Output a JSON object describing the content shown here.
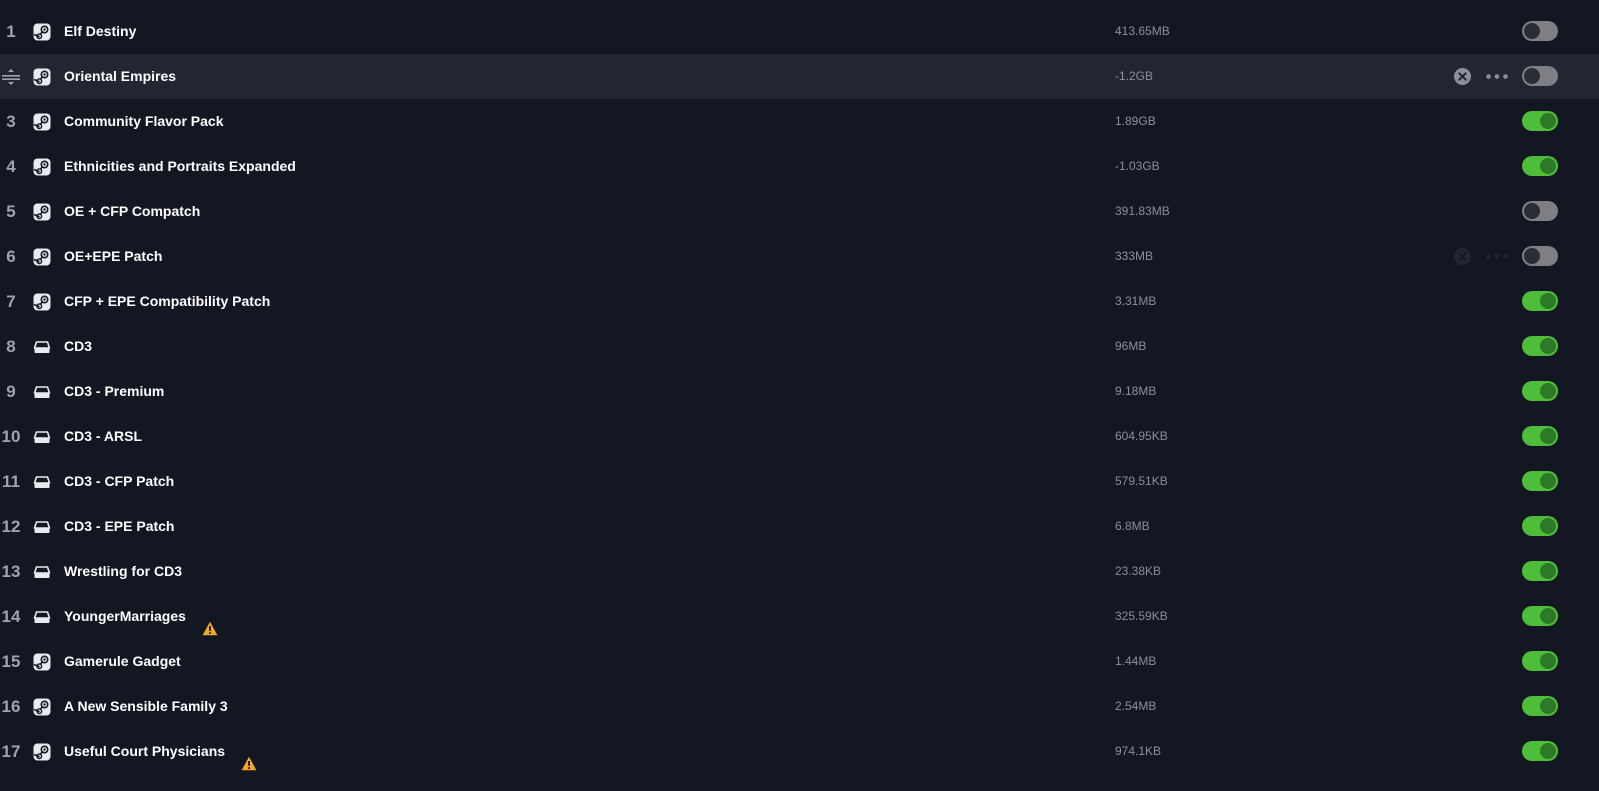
{
  "colors": {
    "background": "#131722",
    "row_hover": "#222631",
    "toggle_on": "#4dbd3a",
    "toggle_off": "#7d7f84",
    "warning": "#f5a623"
  },
  "mods": [
    {
      "index": "1",
      "name": "Elf Destiny",
      "size": "413.65MB",
      "source": "steam-icon",
      "enabled": false,
      "warning": false,
      "hover": false,
      "faint_actions": false
    },
    {
      "index": "2",
      "name": "Oriental Empires",
      "size": "-1.2GB",
      "source": "steam-icon",
      "enabled": false,
      "warning": false,
      "hover": true,
      "faint_actions": false
    },
    {
      "index": "3",
      "name": "Community Flavor Pack",
      "size": "1.89GB",
      "source": "steam-icon",
      "enabled": true,
      "warning": false,
      "hover": false,
      "faint_actions": false
    },
    {
      "index": "4",
      "name": "Ethnicities and Portraits Expanded",
      "size": "-1.03GB",
      "source": "steam-icon",
      "enabled": true,
      "warning": false,
      "hover": false,
      "faint_actions": false
    },
    {
      "index": "5",
      "name": "OE + CFP Compatch",
      "size": "391.83MB",
      "source": "steam-icon",
      "enabled": false,
      "warning": false,
      "hover": false,
      "faint_actions": false
    },
    {
      "index": "6",
      "name": "OE+EPE Patch",
      "size": "333MB",
      "source": "steam-icon",
      "enabled": false,
      "warning": false,
      "hover": false,
      "faint_actions": true
    },
    {
      "index": "7",
      "name": "CFP + EPE Compatibility Patch",
      "size": "3.31MB",
      "source": "steam-icon",
      "enabled": true,
      "warning": false,
      "hover": false,
      "faint_actions": false
    },
    {
      "index": "8",
      "name": "CD3",
      "size": "96MB",
      "source": "local-drive-icon",
      "enabled": true,
      "warning": false,
      "hover": false,
      "faint_actions": false
    },
    {
      "index": "9",
      "name": "CD3 - Premium",
      "size": "9.18MB",
      "source": "local-drive-icon",
      "enabled": true,
      "warning": false,
      "hover": false,
      "faint_actions": false
    },
    {
      "index": "10",
      "name": "CD3 - ARSL",
      "size": "604.95KB",
      "source": "local-drive-icon",
      "enabled": true,
      "warning": false,
      "hover": false,
      "faint_actions": false
    },
    {
      "index": "11",
      "name": "CD3 - CFP Patch",
      "size": "579.51KB",
      "source": "local-drive-icon",
      "enabled": true,
      "warning": false,
      "hover": false,
      "faint_actions": false
    },
    {
      "index": "12",
      "name": "CD3 - EPE Patch",
      "size": "6.8MB",
      "source": "local-drive-icon",
      "enabled": true,
      "warning": false,
      "hover": false,
      "faint_actions": false
    },
    {
      "index": "13",
      "name": "Wrestling for CD3",
      "size": "23.38KB",
      "source": "local-drive-icon",
      "enabled": true,
      "warning": false,
      "hover": false,
      "faint_actions": false
    },
    {
      "index": "14",
      "name": "YoungerMarriages",
      "size": "325.59KB",
      "source": "local-drive-icon",
      "enabled": true,
      "warning": true,
      "hover": false,
      "faint_actions": false
    },
    {
      "index": "15",
      "name": "Gamerule Gadget",
      "size": "1.44MB",
      "source": "steam-icon",
      "enabled": true,
      "warning": false,
      "hover": false,
      "faint_actions": false
    },
    {
      "index": "16",
      "name": "A New Sensible Family 3",
      "size": "2.54MB",
      "source": "steam-icon",
      "enabled": true,
      "warning": false,
      "hover": false,
      "faint_actions": false
    },
    {
      "index": "17",
      "name": "Useful Court Physicians",
      "size": "974.1KB",
      "source": "steam-icon",
      "enabled": true,
      "warning": true,
      "hover": false,
      "faint_actions": false
    }
  ]
}
